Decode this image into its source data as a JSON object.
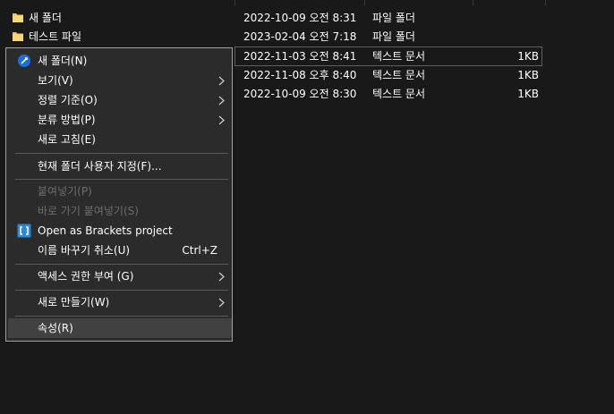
{
  "file_list": {
    "rows": [
      {
        "name": "새 폴더",
        "date": "2022-10-09 오전 8:31",
        "type": "파일 폴더",
        "size": "",
        "icon": "folder-icon"
      },
      {
        "name": "테스트 파일",
        "date": "2023-02-04 오전 7:18",
        "type": "파일 폴더",
        "size": "",
        "icon": "folder-icon"
      },
      {
        "name": "",
        "date": "2022-11-03 오전 8:41",
        "type": "텍스트 문서",
        "size": "1KB",
        "icon": ""
      },
      {
        "name": "",
        "date": "2022-11-08 오후 8:40",
        "type": "텍스트 문서",
        "size": "1KB",
        "icon": ""
      },
      {
        "name": "",
        "date": "2022-10-09 오전 8:30",
        "type": "텍스트 문서",
        "size": "1KB",
        "icon": ""
      }
    ]
  },
  "context_menu": {
    "new_folder": "새 폴더(N)",
    "view": "보기(V)",
    "sort_by": "정렬 기준(O)",
    "group_by": "분류 방법(P)",
    "refresh": "새로 고침(E)",
    "customize_folder": "현재 폴더 사용자 지정(F)...",
    "paste": "붙여넣기(P)",
    "paste_shortcut": "바로 가기 붙여넣기(S)",
    "open_brackets": "Open as Brackets project",
    "undo_rename": "이름 바꾸기 취소(U)",
    "undo_rename_shortcut": "Ctrl+Z",
    "give_access": "액세스 권한 부여 (G)",
    "new_item": "새로 만들기(W)",
    "properties": "속성(R)"
  },
  "colors": {
    "background": "#191919",
    "menu_background": "#2b2b2b",
    "folder_yellow": "#f2c55c",
    "new_folder_icon_blue": "#1a6fe0",
    "brackets_blue": "#2a8ad4"
  }
}
